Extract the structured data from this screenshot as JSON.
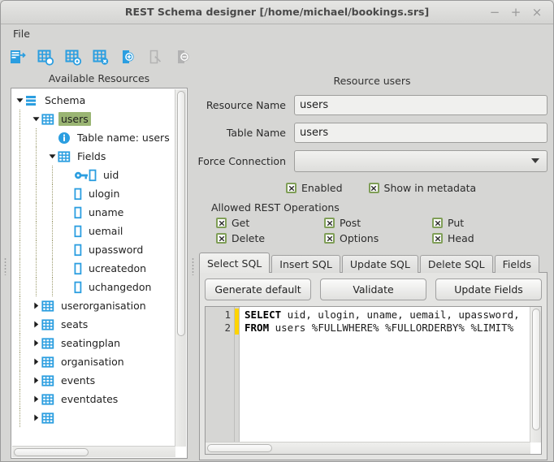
{
  "window": {
    "title": "REST Schema designer [/home/michael/bookings.srs]",
    "minimize": "−",
    "maximize": "+",
    "close": "×"
  },
  "menu": {
    "items": [
      "File"
    ]
  },
  "toolbar": {
    "buttons": [
      {
        "name": "new-schema-icon",
        "enabled": true
      },
      {
        "name": "add-table-icon",
        "enabled": true
      },
      {
        "name": "edit-table-icon",
        "enabled": true
      },
      {
        "name": "delete-table-icon",
        "enabled": true
      },
      {
        "name": "add-resource-icon",
        "enabled": true
      },
      {
        "name": "edit-resource-icon",
        "enabled": false
      },
      {
        "name": "delete-resource-icon",
        "enabled": false
      }
    ]
  },
  "left_panel": {
    "title": "Available Resources",
    "tree": [
      {
        "label": "Schema",
        "depth": 0,
        "icon": "schema-icon",
        "arrow": "down",
        "selected": false
      },
      {
        "label": "users",
        "depth": 1,
        "icon": "table-icon",
        "arrow": "down",
        "selected": true
      },
      {
        "label": "Table name: users",
        "depth": 2,
        "icon": "info-icon",
        "arrow": "none",
        "selected": false
      },
      {
        "label": "Fields",
        "depth": 2,
        "icon": "table-icon",
        "arrow": "down",
        "selected": false
      },
      {
        "label": "uid",
        "depth": 3,
        "icon": "key-field-icon",
        "arrow": "none",
        "selected": false
      },
      {
        "label": "ulogin",
        "depth": 3,
        "icon": "field-icon",
        "arrow": "none",
        "selected": false
      },
      {
        "label": "uname",
        "depth": 3,
        "icon": "field-icon",
        "arrow": "none",
        "selected": false
      },
      {
        "label": "uemail",
        "depth": 3,
        "icon": "field-icon",
        "arrow": "none",
        "selected": false
      },
      {
        "label": "upassword",
        "depth": 3,
        "icon": "field-icon",
        "arrow": "none",
        "selected": false
      },
      {
        "label": "ucreatedon",
        "depth": 3,
        "icon": "field-icon",
        "arrow": "none",
        "selected": false
      },
      {
        "label": "uchangedon",
        "depth": 3,
        "icon": "field-icon",
        "arrow": "none",
        "selected": false
      },
      {
        "label": "userorganisation",
        "depth": 1,
        "icon": "table-icon",
        "arrow": "right",
        "selected": false
      },
      {
        "label": "seats",
        "depth": 1,
        "icon": "table-icon",
        "arrow": "right",
        "selected": false
      },
      {
        "label": "seatingplan",
        "depth": 1,
        "icon": "table-icon",
        "arrow": "right",
        "selected": false
      },
      {
        "label": "organisation",
        "depth": 1,
        "icon": "table-icon",
        "arrow": "right",
        "selected": false
      },
      {
        "label": "events",
        "depth": 1,
        "icon": "table-icon",
        "arrow": "right",
        "selected": false
      },
      {
        "label": "eventdates",
        "depth": 1,
        "icon": "table-icon",
        "arrow": "right",
        "selected": false
      },
      {
        "label": "",
        "depth": 1,
        "icon": "table-icon",
        "arrow": "right",
        "selected": false
      }
    ]
  },
  "right_panel": {
    "heading": "Resource users",
    "fields": {
      "resource_name_label": "Resource Name",
      "resource_name_value": "users",
      "table_name_label": "Table Name",
      "table_name_value": "users",
      "force_connection_label": "Force Connection",
      "force_connection_value": ""
    },
    "toggles": [
      {
        "label": "Enabled",
        "checked": true
      },
      {
        "label": "Show in metadata",
        "checked": true
      }
    ],
    "operations_title": "Allowed REST Operations",
    "operations": [
      {
        "label": "Get",
        "checked": true
      },
      {
        "label": "Post",
        "checked": true
      },
      {
        "label": "Put",
        "checked": true
      },
      {
        "label": "Delete",
        "checked": true
      },
      {
        "label": "Options",
        "checked": true
      },
      {
        "label": "Head",
        "checked": true
      }
    ],
    "tabs": [
      {
        "label": "Select SQL",
        "active": true
      },
      {
        "label": "Insert SQL",
        "active": false
      },
      {
        "label": "Update SQL",
        "active": false
      },
      {
        "label": "Delete SQL",
        "active": false
      },
      {
        "label": "Fields",
        "active": false
      }
    ],
    "tab_buttons": [
      "Generate default",
      "Validate",
      "Update Fields"
    ],
    "sql_editor": {
      "line_numbers": [
        "1",
        "2"
      ],
      "lines": [
        {
          "keyword": "SELECT",
          "rest": " uid, ulogin, uname, uemail, upassword,"
        },
        {
          "keyword": "FROM",
          "rest": " users %FULLWHERE% %FULLORDERBY% %LIMIT%"
        }
      ]
    }
  },
  "colors": {
    "accent_blue": "#2b9ee0",
    "selection_green": "#9ab573",
    "checkbox_green": "#7f9e57",
    "window_bg": "#d6d6d4",
    "editor_bg": "#ffffff",
    "marker_yellow": "#ffd400"
  }
}
